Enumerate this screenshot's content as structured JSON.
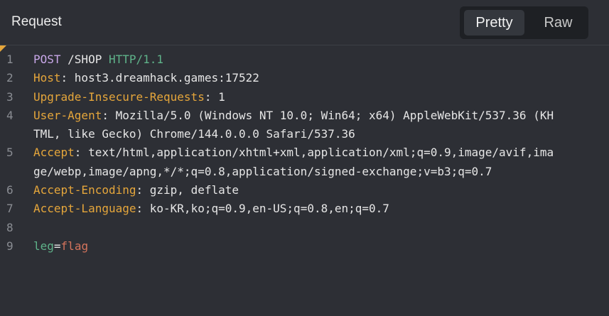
{
  "panel": {
    "title": "Request",
    "view_toggle": {
      "pretty_label": "Pretty",
      "raw_label": "Raw",
      "selected": "Pretty"
    }
  },
  "request": {
    "request_line": {
      "method": "POST",
      "path": " /SHOP ",
      "version": "HTTP/1.1"
    },
    "headers": [
      {
        "name": "Host",
        "value": "host3.dreamhack.games:17522"
      },
      {
        "name": "Upgrade-Insecure-Requests",
        "value": "1"
      },
      {
        "name": "User-Agent",
        "value": "Mozilla/5.0 (Windows NT 10.0; Win64; x64) AppleWebKit/537.36 (KH",
        "value_cont": "TML, like Gecko) Chrome/144.0.0.0 Safari/537.36"
      },
      {
        "name": "Accept",
        "value": "text/html,application/xhtml+xml,application/xml;q=0.9,image/avif,ima",
        "value_cont": "ge/webp,image/apng,*/*;q=0.8,application/signed-exchange;v=b3;q=0.7"
      },
      {
        "name": "Accept-Encoding",
        "value": "gzip, deflate"
      },
      {
        "name": "Accept-Language",
        "value": "ko-KR,ko;q=0.9,en-US;q=0.8,en;q=0.7"
      }
    ],
    "body": {
      "key": "leg",
      "eq": "=",
      "value": "flag"
    },
    "line_numbers": [
      "1",
      "2",
      "3",
      "4",
      "5",
      "6",
      "7",
      "8",
      "9"
    ]
  },
  "colors": {
    "background": "#2d2f35",
    "header_name": "#e5a63b",
    "method": "#c8a7e8",
    "version": "#5fb38a",
    "body_key": "#5fb38a",
    "body_value": "#d4745c"
  }
}
